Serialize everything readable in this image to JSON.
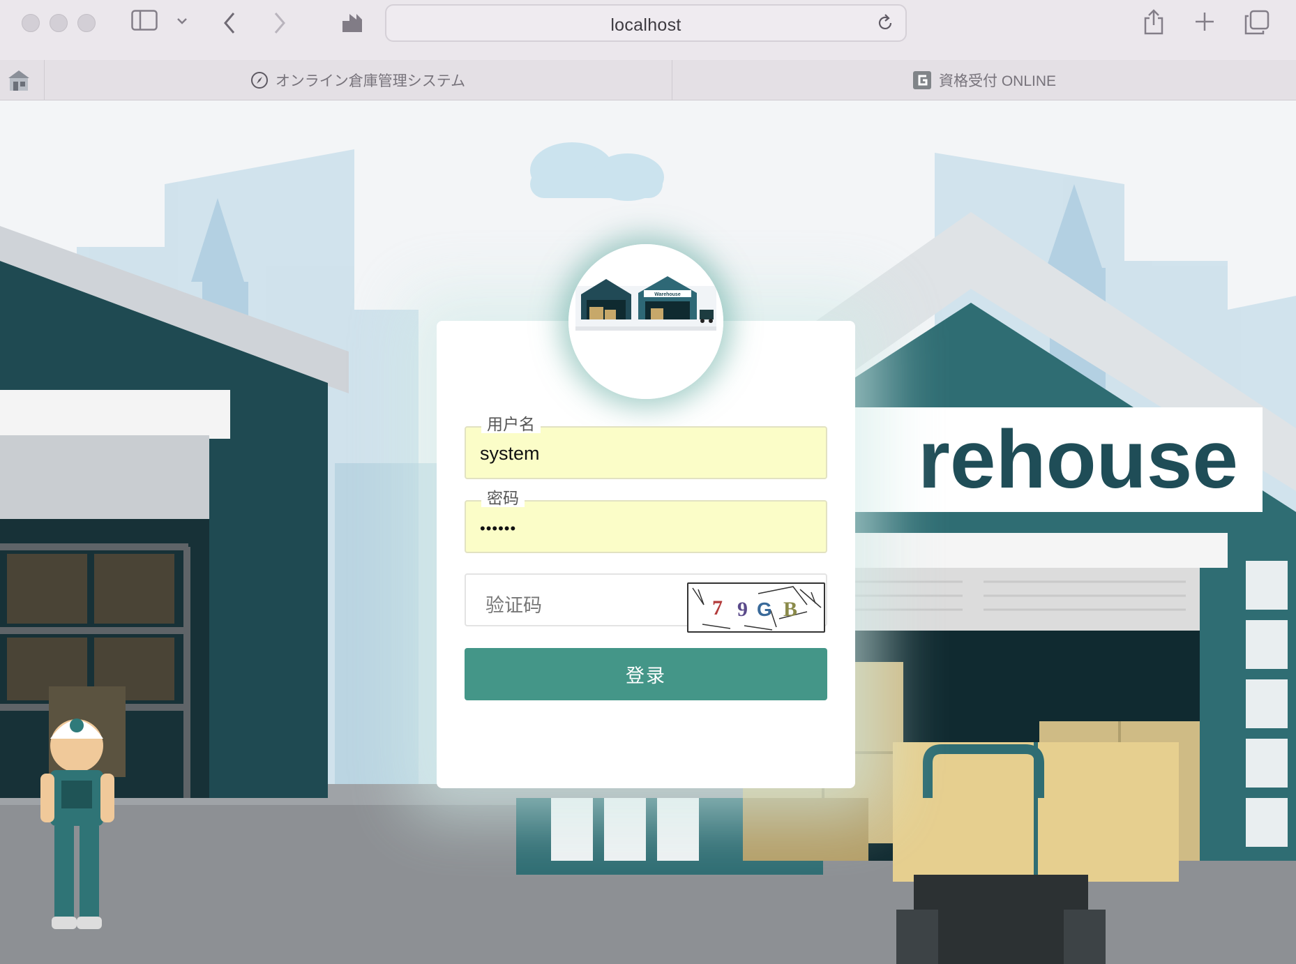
{
  "browser": {
    "url": "localhost",
    "favorites": [
      {
        "label": "オンライン倉庫管理システム",
        "icon": "compass-icon"
      },
      {
        "label": "資格受付 ONLINE",
        "icon": "site-favicon-icon"
      }
    ]
  },
  "background": {
    "sign_text": "rehouse",
    "small_sign_text": "Warehouse"
  },
  "login": {
    "username_label": "用户名",
    "username_value": "system",
    "password_label": "密码",
    "password_value": "••••••",
    "captcha_placeholder": "验证码",
    "captcha_chars": [
      "7",
      "9",
      "G",
      "B"
    ],
    "submit_label": "登录"
  },
  "colors": {
    "accent": "#449688",
    "field_autofill": "#fbfdc8",
    "warehouse_teal": "#2f6d73",
    "warehouse_dark": "#173a42"
  }
}
